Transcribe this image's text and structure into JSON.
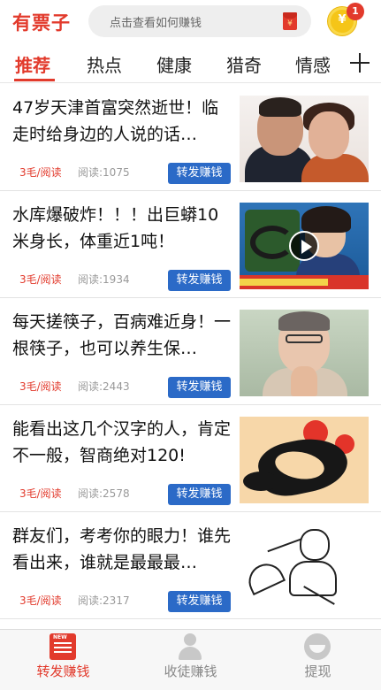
{
  "header": {
    "logo": "有票子",
    "search_placeholder": "点击查看如何赚钱",
    "envelope_glyph": "¥",
    "coin_glyph": "¥",
    "coin_badge": "1"
  },
  "tabs": [
    {
      "label": "推荐",
      "active": true
    },
    {
      "label": "热点",
      "active": false
    },
    {
      "label": "健康",
      "active": false
    },
    {
      "label": "猎奇",
      "active": false
    },
    {
      "label": "情感",
      "active": false
    }
  ],
  "feed": [
    {
      "title": "47岁天津首富突然逝世！临走时给身边的人说的话…",
      "price": "3毛/阅读",
      "reads": "阅读:1075",
      "share": "转发赚钱",
      "video": false
    },
    {
      "title": "水库爆破炸！！！出巨蟒10米身长，体重近1吨！",
      "price": "3毛/阅读",
      "reads": "阅读:1934",
      "share": "转发赚钱",
      "video": true
    },
    {
      "title": "每天搓筷子，百病难近身！一根筷子，也可以养生保…",
      "price": "3毛/阅读",
      "reads": "阅读:2443",
      "share": "转发赚钱",
      "video": false
    },
    {
      "title": "能看出这几个汉字的人，肯定不一般，智商绝对120!",
      "price": "3毛/阅读",
      "reads": "阅读:2578",
      "share": "转发赚钱",
      "video": false
    },
    {
      "title": "群友们，考考你的眼力！谁先看出来，谁就是最最最…",
      "price": "3毛/阅读",
      "reads": "阅读:2317",
      "share": "转发赚钱",
      "video": false
    }
  ],
  "bottom_nav": [
    {
      "label": "转发赚钱",
      "icon": "news-icon",
      "active": true
    },
    {
      "label": "收徒赚钱",
      "icon": "user-icon",
      "active": false
    },
    {
      "label": "提现",
      "icon": "withdraw-icon",
      "active": false
    }
  ],
  "colors": {
    "accent": "#e23a2c",
    "share_button": "#2b6ac7",
    "coin": "#f5c518"
  }
}
